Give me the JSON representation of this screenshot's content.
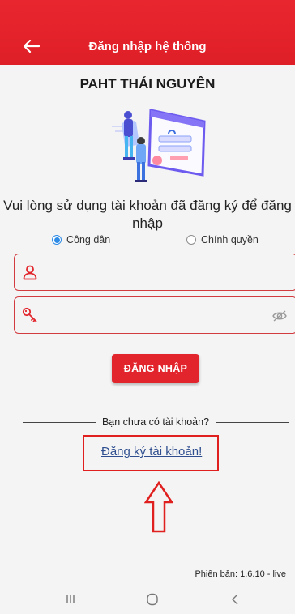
{
  "appbar": {
    "title": "Đăng nhập hệ thống",
    "back_icon": "arrow-left-icon"
  },
  "app_title": "PAHT THÁI NGUYÊN",
  "instruction": "Vui lòng sử dụng tài khoản đã đăng ký để đăng nhập",
  "account_type": {
    "options": [
      {
        "label": "Công dân",
        "selected": true
      },
      {
        "label": "Chính quyền",
        "selected": false
      }
    ]
  },
  "form": {
    "username": {
      "value": "",
      "placeholder": "",
      "icon": "user-icon"
    },
    "password": {
      "value": "",
      "placeholder": "",
      "icon": "key-icon",
      "toggle_icon": "eye-off-icon"
    }
  },
  "login_button": "ĐĂNG NHẬP",
  "no_account_text": "Bạn chưa có tài khoản?",
  "register_link": "Đăng ký tài khoản!",
  "version": "Phiên bản: 1.6.10 - live",
  "colors": {
    "primary": "#e2252c",
    "radio_accent": "#2e8be6",
    "link": "#2e4e8f",
    "highlight": "#e0201f"
  },
  "system_nav": {
    "recent_icon": "recent-apps-icon",
    "home_icon": "home-icon",
    "back_icon": "back-icon"
  }
}
